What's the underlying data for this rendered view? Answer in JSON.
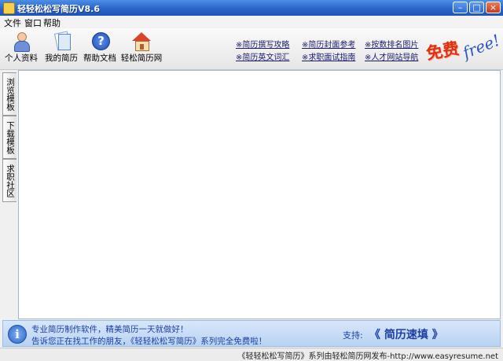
{
  "window": {
    "title": "轻轻松松写简历V8.6",
    "buttons": {
      "minimize": "–",
      "maximize": "□",
      "close": "×"
    }
  },
  "menubar": {
    "items": [
      "文件",
      "窗口",
      "帮助"
    ]
  },
  "toolbar": {
    "buttons": [
      {
        "label": "个人资料",
        "icon": "user-profile-icon"
      },
      {
        "label": "我的简历",
        "icon": "resume-document-icon"
      },
      {
        "label": "帮助文档",
        "icon": "help-icon"
      },
      {
        "label": "轻松简历网",
        "icon": "home-icon"
      }
    ],
    "links": [
      "※简历撰写攻略",
      "※简历封面参考",
      "※按数排名图片",
      "※简历英文词汇",
      "※求职面试指南",
      "※人才网站导航"
    ],
    "badge": {
      "cn": "免费",
      "en": "free!"
    }
  },
  "side_tabs": [
    "浏览模板",
    "下载模板",
    "求职社区"
  ],
  "promo": {
    "line1": "专业简历制作软件，精美简历一天就做好！",
    "line2": "告诉您正在找工作的朋友，《轻轻松松写简历》系列完全免费啦！",
    "support_label": "支持:",
    "support_link": "《 简历速填 》"
  },
  "statusbar": {
    "text": "《轻轻松松写简历》系列由轻松简历网发布-http://www.easyresume.net"
  },
  "colors": {
    "titlebar": "#2a64c9",
    "promo_text": "#1b3fa0",
    "badge_red": "#e03010",
    "badge_blue": "#2a55c8"
  }
}
